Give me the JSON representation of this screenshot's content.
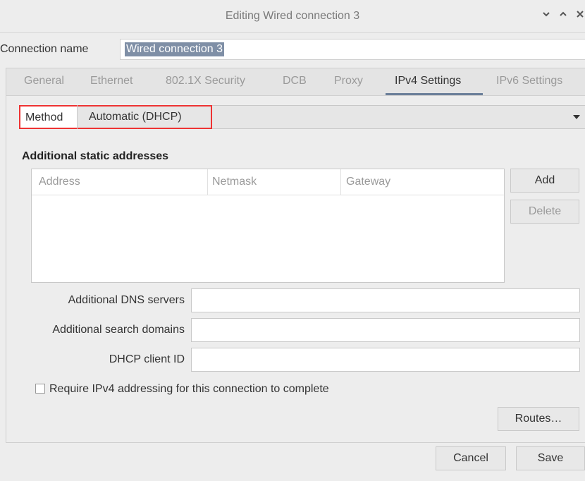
{
  "window": {
    "title": "Editing Wired connection 3"
  },
  "connection": {
    "label": "Connection name",
    "value": "Wired connection 3"
  },
  "tabs": [
    {
      "label": "General",
      "active": false
    },
    {
      "label": "Ethernet",
      "active": false
    },
    {
      "label": "802.1X Security",
      "active": false
    },
    {
      "label": "DCB",
      "active": false
    },
    {
      "label": "Proxy",
      "active": false
    },
    {
      "label": "IPv4 Settings",
      "active": true
    },
    {
      "label": "IPv6 Settings",
      "active": false
    }
  ],
  "ipv4": {
    "method_label": "Method",
    "method_value": "Automatic (DHCP)",
    "static_title": "Additional static addresses",
    "columns": [
      "Address",
      "Netmask",
      "Gateway"
    ],
    "add_button": "Add",
    "delete_button": "Delete",
    "dns_label": "Additional DNS servers",
    "dns_value": "",
    "search_label": "Additional search domains",
    "search_value": "",
    "dhcp_label": "DHCP client ID",
    "dhcp_value": "",
    "require_label": "Require IPv4 addressing for this connection to complete",
    "require_checked": false,
    "routes_button": "Routes…"
  },
  "footer": {
    "cancel_button": "Cancel",
    "save_button": "Save"
  }
}
